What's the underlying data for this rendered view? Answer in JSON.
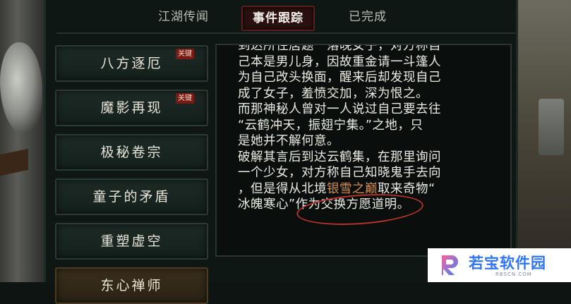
{
  "tabs": [
    {
      "label": "江湖传闻",
      "active": false
    },
    {
      "label": "事件跟踪",
      "active": true
    },
    {
      "label": "已完成",
      "active": false
    }
  ],
  "quests": [
    {
      "label": "八方逐厄",
      "badge": "关键"
    },
    {
      "label": "魔影再现",
      "badge": "关键"
    },
    {
      "label": "极秘卷宗",
      "badge": ""
    },
    {
      "label": "童子的矛盾",
      "badge": ""
    },
    {
      "label": "重塑虚空",
      "badge": ""
    },
    {
      "label": "东心禅师",
      "badge": ""
    }
  ],
  "description": {
    "line1": "到达所住居题一落晚女子，对方称自",
    "line2": "己本是男儿身，因故重金请一斗篷人",
    "line3": "为自己改头换面，醒来后却发现自己",
    "line4": "成了女子，羞愤交加，深为恨之。",
    "line5": "而那神秘人曾对一人说过自己要去往",
    "line6": "“云鹤冲天，振翅宁集。”之地，只",
    "line7": "是她并不解何意。",
    "line8": "破解其言后到达云鹤集，在那里询问",
    "line9": "一个少女，对方称自己知晓鬼手去向",
    "line10_a": "，但是得从北境",
    "line10_hl": "银雪之巅",
    "line10_b": "取来奇物“",
    "line11": "冰魄寒心”作为交换方愿道明。"
  },
  "watermark": {
    "text": "若宝软件园",
    "sub": "RBSCN.COM"
  },
  "colors": {
    "highlight": "#d38b4f",
    "annotation_ring": "#b3322a",
    "badge": "#7a1a14",
    "watermark_blue": "#2f76f6"
  }
}
